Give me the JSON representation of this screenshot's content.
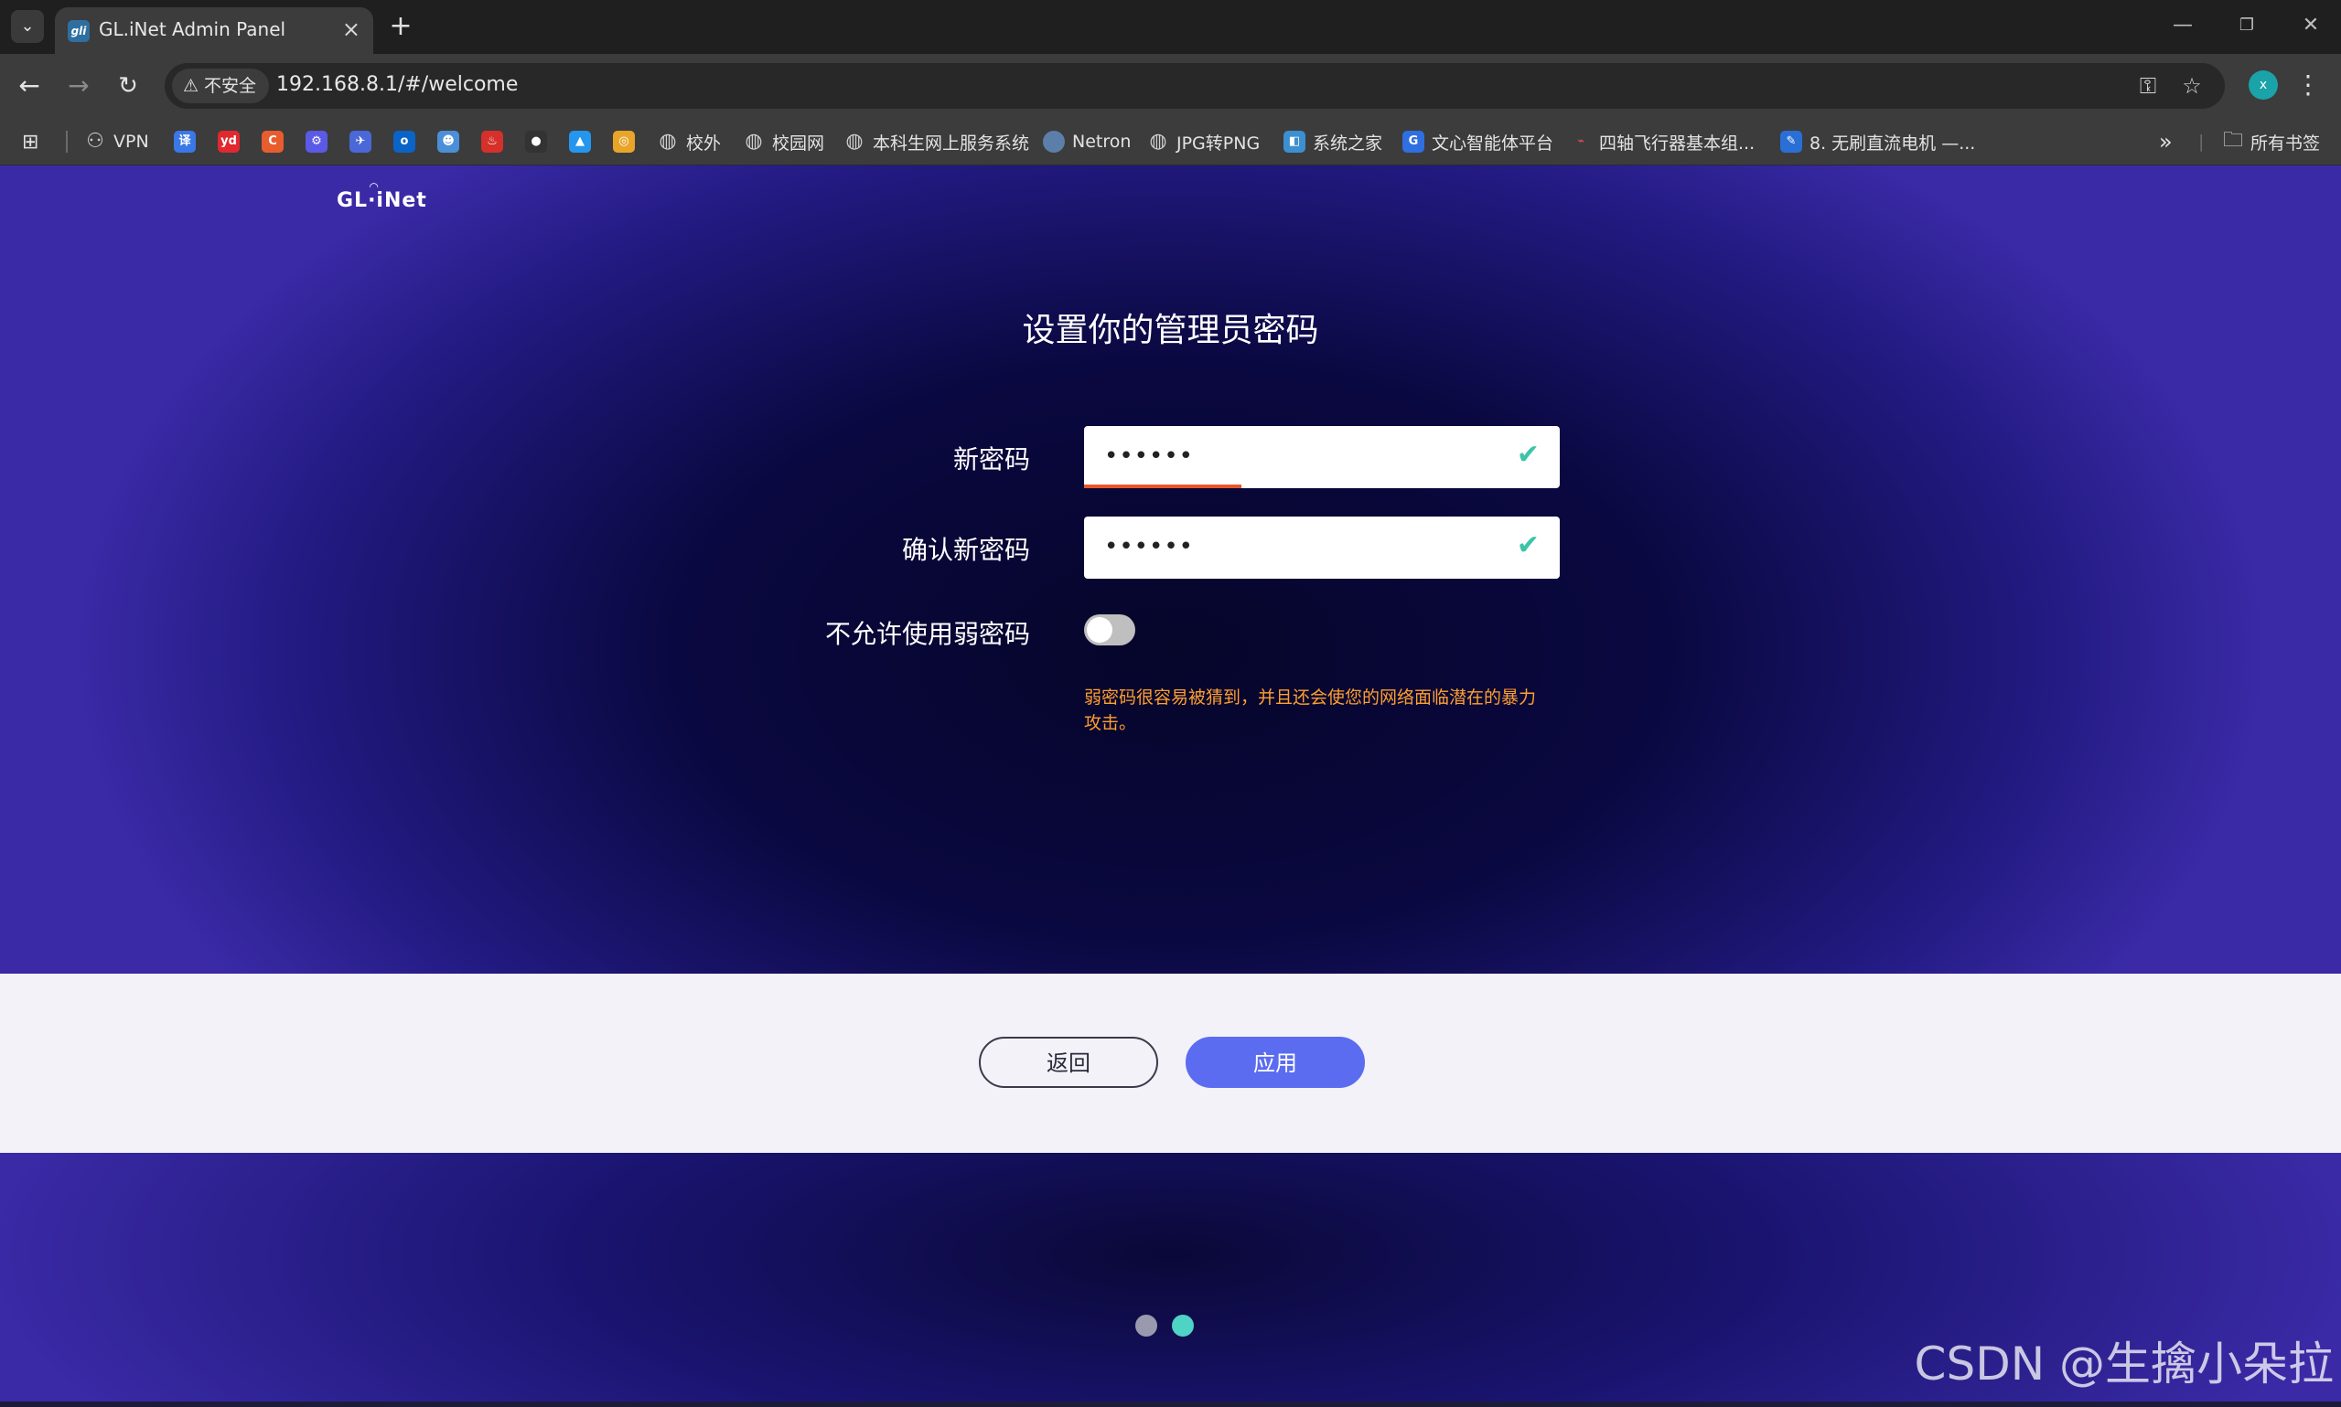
{
  "browser": {
    "tab_title": "GL.iNet Admin Panel",
    "tab_favicon": "gli",
    "security_label": "不安全",
    "url": "192.168.8.1/#/welcome",
    "profile_initial": "x",
    "bookmarks": [
      {
        "label": "VPN",
        "icon": "vpn-icon"
      },
      {
        "label": "",
        "icon": "translate-icon",
        "glyph": "译",
        "color": "#3b78e7"
      },
      {
        "label": "",
        "icon": "youdao-icon",
        "glyph": "yd",
        "color": "#e0282e"
      },
      {
        "label": "",
        "icon": "csdn-icon",
        "glyph": "C",
        "color": "#e85d2d"
      },
      {
        "label": "",
        "icon": "settings-app-icon",
        "glyph": "⚙",
        "color": "#5a5ae6"
      },
      {
        "label": "",
        "icon": "bird-icon",
        "glyph": "✈",
        "color": "#4a68d8"
      },
      {
        "label": "",
        "icon": "outlook-icon",
        "glyph": "o",
        "color": "#0a64c8"
      },
      {
        "label": "",
        "icon": "robot-icon",
        "glyph": "☻",
        "color": "#4a8fd8"
      },
      {
        "label": "",
        "icon": "octopus-icon",
        "glyph": "♨",
        "color": "#d6302a"
      },
      {
        "label": "",
        "icon": "github-icon",
        "glyph": "●",
        "color": "#333333"
      },
      {
        "label": "",
        "icon": "docker-icon",
        "glyph": "▲",
        "color": "#2496ed"
      },
      {
        "label": "",
        "icon": "orange-icon",
        "glyph": "◎",
        "color": "#e8a52a"
      },
      {
        "label": "校外",
        "icon": "globe-icon"
      },
      {
        "label": "校园网",
        "icon": "globe-icon"
      },
      {
        "label": "本科生网上服务系统",
        "icon": "globe-icon"
      },
      {
        "label": "Netron",
        "icon": "netron-icon"
      },
      {
        "label": "JPG转PNG",
        "icon": "globe-icon"
      },
      {
        "label": "系统之家",
        "icon": "xtzj-icon"
      },
      {
        "label": "文心智能体平台",
        "icon": "wenxin-icon"
      },
      {
        "label": "四轴飞行器基本组...",
        "icon": "drone-icon"
      },
      {
        "label": "8. 无刷直流电机 —...",
        "icon": "doc-icon"
      }
    ],
    "more_bookmarks": "»",
    "all_bookmarks": "所有书签"
  },
  "page": {
    "logo": "GL·iNet",
    "title": "设置你的管理员密码",
    "new_password": {
      "label": "新密码",
      "value": "••••••",
      "strength": 0.33
    },
    "confirm_password": {
      "label": "确认新密码",
      "value": "••••••"
    },
    "weak_password_toggle": {
      "label": "不允许使用弱密码",
      "on": false
    },
    "warning": "弱密码很容易被猜到，并且还会使您的网络面临潜在的暴力攻击。",
    "back_button": "返回",
    "apply_button": "应用",
    "pager": {
      "total": 2,
      "current": 2
    },
    "watermark": "CSDN @生擒小朵拉"
  },
  "colors": {
    "accent": "#5b6cf0",
    "check": "#3cc4a8",
    "warning": "#ff9f2e",
    "strength_bar": "#e8562c"
  }
}
